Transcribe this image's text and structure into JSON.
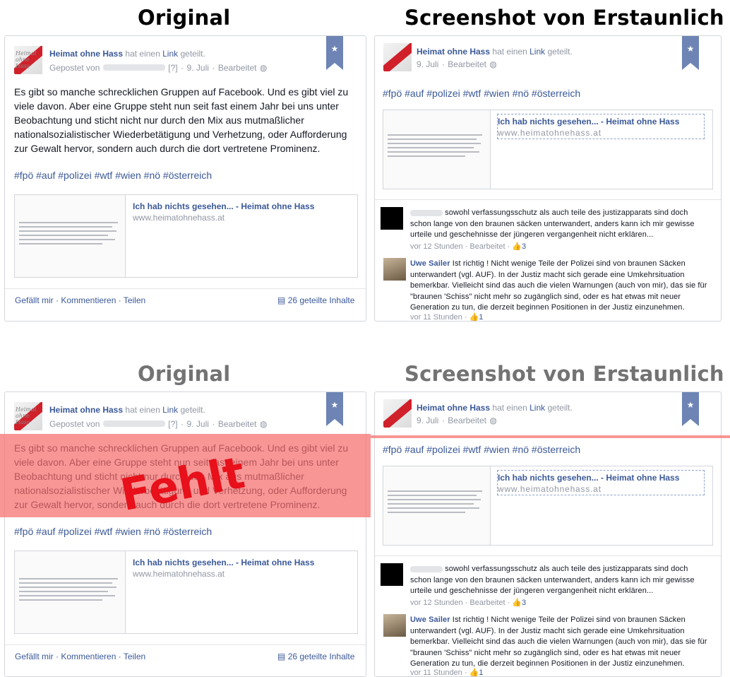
{
  "headings": {
    "top_left": "Original",
    "top_right": "Screenshot von Erstaunlich",
    "bottom_left": "Original",
    "bottom_right": "Screenshot von Erstaunlich"
  },
  "colors": {
    "heading_dark": "#000000",
    "heading_gray": "#737373",
    "facebook_blue": "#3b5998",
    "bookmark_blue": "#6d84b4",
    "overlay_red": "#f56e6e",
    "fehlt_red": "#e8101a"
  },
  "original_post": {
    "page_name": "Heimat ohne Hass",
    "shared_text": "hat einen",
    "link_word": "Link",
    "geteilt": "geteilt.",
    "posted_by": "Gepostet von",
    "question": "[?]",
    "date": "9. Juli",
    "edited": "Bearbeitet",
    "body": "Es gibt so manche schrecklichen Gruppen auf Facebook. Und es gibt viel zu viele davon. Aber eine Gruppe steht nun seit fast einem Jahr bei uns unter Beobachtung und sticht nicht nur durch den Mix aus mutmaßlicher nationalsozialistischer Wiederbetätigung und Verhetzung, oder Aufforderung zur Gewalt hervor, sondern auch durch die dort vertretene Prominenz.",
    "tags": "#fpö #auf #polizei #wtf #wien #nö #österreich",
    "link_title": "Ich hab nichts gesehen... - Heimat ohne Hass",
    "link_domain": "www.heimatohnehass.at",
    "actions": "Gefällt mir · Kommentieren · Teilen",
    "shares": "26 geteilte Inhalte",
    "avatar_text": "Heimat ohne Hass",
    "bookmark_icon": "star-icon"
  },
  "screenshot_post": {
    "page_name": "Heimat ohne Hass",
    "shared_text": "hat einen",
    "link_word": "Link",
    "geteilt": "geteilt.",
    "date": "9. Juli",
    "edited": "Bearbeitet",
    "tags": "#fpö #auf #polizei #wtf #wien #nö #österreich",
    "link_title": "Ich hab nichts gesehen... - Heimat ohne Hass",
    "link_domain": "www.heimatohnehass.at",
    "comments": [
      {
        "name": "",
        "text": "sowohl verfassungsschutz als auch teile des justizapparats sind doch schon lange von den braunen säcken unterwandert, anders kann ich mir gewisse urteile und geschehnisse der jüngeren vergangenheit nicht erklären...",
        "time": "vor 12 Stunden",
        "edited": "Bearbeitet",
        "likes": "3"
      },
      {
        "name": "Uwe Sailer",
        "text": "Ist richtig ! Nicht wenige Teile der Polizei sind von braunen Säcken unterwandert (vgl. AUF). In der Justiz macht sich gerade eine Umkehrsituation bemerkbar. Vielleicht sind das auch die vielen Warnungen (auch von mir), das sie für \"braunen 'Schiss\" nicht mehr so zugänglich sind, oder es hat etwas mit neuer Generation zu tun, die derzeit beginnen Positionen in der Justiz einzunehmen.",
        "time": "vor 11 Stunden",
        "likes": "1"
      }
    ]
  },
  "overlay": {
    "label": "Fehlt"
  }
}
